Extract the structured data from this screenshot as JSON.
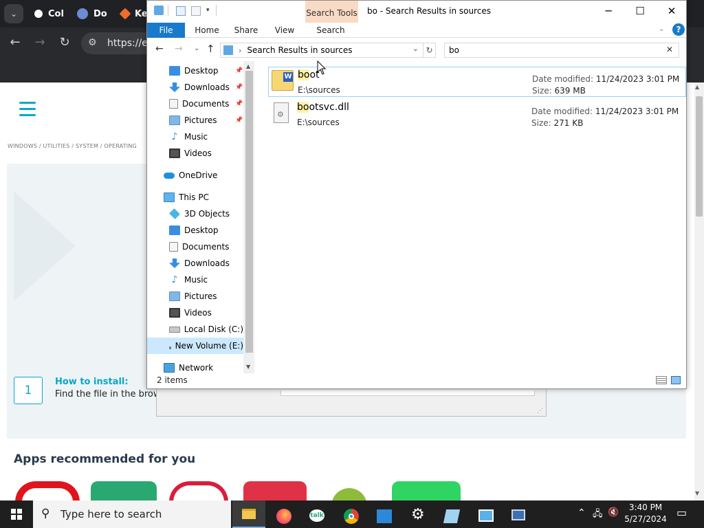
{
  "browser": {
    "tabs": [
      {
        "label": "Col",
        "color": "#ffffff"
      },
      {
        "label": "Do",
        "color": "#6d8ad4"
      },
      {
        "label": "Ke",
        "color": "#f26b2a"
      }
    ],
    "url": "https://e"
  },
  "webpage": {
    "breadcrumb": "WINDOWS   /   UTILITIES   /   SYSTEM   /   OPERATING",
    "step_number": "1",
    "howto_title": "How to install:",
    "howto_text": "Find the file in the brows",
    "apps_title": "Apps recommended for you",
    "accent_color": "#0aa7c9"
  },
  "explorer": {
    "context_tab": "Search Tools",
    "title": "bo - Search Results in sources",
    "ribbon_tabs": [
      "File",
      "Home",
      "Share",
      "View",
      "Search"
    ],
    "address": "Search Results in sources",
    "search_query": "bo",
    "nav": {
      "quick_access": [
        {
          "label": "Desktop",
          "icon": "desktop-icon",
          "pinned": true
        },
        {
          "label": "Downloads",
          "icon": "downloads-icon",
          "pinned": true
        },
        {
          "label": "Documents",
          "icon": "documents-icon",
          "pinned": true
        },
        {
          "label": "Pictures",
          "icon": "pictures-icon",
          "pinned": true
        },
        {
          "label": "Music",
          "icon": "music-icon",
          "pinned": false
        },
        {
          "label": "Videos",
          "icon": "videos-icon",
          "pinned": false
        }
      ],
      "onedrive": "OneDrive",
      "this_pc": "This PC",
      "this_pc_items": [
        {
          "label": "3D Objects",
          "icon": "3d-objects-icon"
        },
        {
          "label": "Desktop",
          "icon": "desktop-icon"
        },
        {
          "label": "Documents",
          "icon": "documents-icon"
        },
        {
          "label": "Downloads",
          "icon": "downloads-icon"
        },
        {
          "label": "Music",
          "icon": "music-icon"
        },
        {
          "label": "Pictures",
          "icon": "pictures-icon"
        },
        {
          "label": "Videos",
          "icon": "videos-icon"
        },
        {
          "label": "Local Disk (C:)",
          "icon": "local-disk-icon"
        },
        {
          "label": "New Volume (E:)",
          "icon": "drive-icon"
        }
      ],
      "network": "Network"
    },
    "results": [
      {
        "match": "bo",
        "rest": "ot",
        "path": "E:\\sources",
        "date_label": "Date modified:",
        "date": "11/24/2023 3:01 PM",
        "size_label": "Size:",
        "size": "639 MB"
      },
      {
        "match": "bo",
        "rest": "otsvc.dll",
        "path": "E:\\sources",
        "date_label": "Date modified:",
        "date": "11/24/2023 3:01 PM",
        "size_label": "Size:",
        "size": "271 KB"
      }
    ],
    "status": "2 items"
  },
  "taskbar": {
    "search_placeholder": "Type here to search",
    "time": "3:40 PM",
    "date": "5/27/2024"
  }
}
